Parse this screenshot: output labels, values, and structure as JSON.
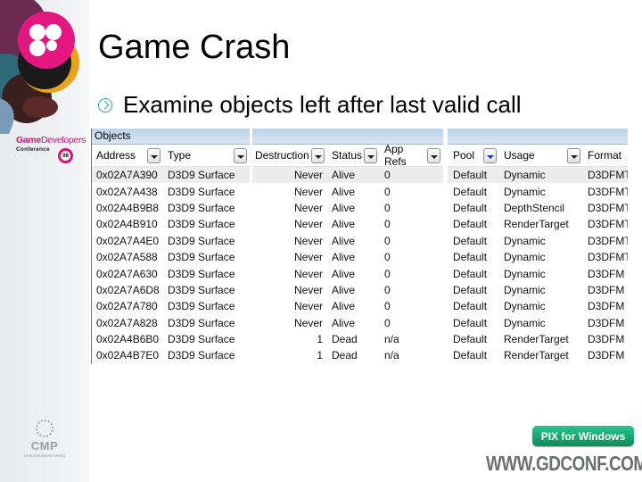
{
  "slide": {
    "title": "Game Crash",
    "bullets": [
      "Examine objects left after last valid call"
    ]
  },
  "branding": {
    "gdc_name_bold": "Game",
    "gdc_name_light": "Developers",
    "gdc_conference": "Conference",
    "gdc_year": "08",
    "cmp": "CMP",
    "cmp_sub": "United Business Media",
    "pix_label": "PIX for Windows",
    "url": "WWW.GDCONF.COM",
    "colors": {
      "gdc_magenta": "#d4147a",
      "pix_green": "#1aa874",
      "bullet_teal": "#2aa3a3"
    }
  },
  "objects_panel": {
    "title": "Objects",
    "columns": [
      "Address",
      "Type",
      "Destruction",
      "Status",
      "App Refs",
      "Pool",
      "Usage",
      "Format"
    ],
    "rows": [
      {
        "address": "0x02A7A390",
        "type": "D3D9 Surface",
        "destruction": "Never",
        "status": "Alive",
        "app_refs": "0",
        "pool": "Default",
        "usage": "Dynamic",
        "format": "D3DFMT"
      },
      {
        "address": "0x02A7A438",
        "type": "D3D9 Surface",
        "destruction": "Never",
        "status": "Alive",
        "app_refs": "0",
        "pool": "Default",
        "usage": "Dynamic",
        "format": "D3DFMT"
      },
      {
        "address": "0x02A4B9B8",
        "type": "D3D9 Surface",
        "destruction": "Never",
        "status": "Alive",
        "app_refs": "0",
        "pool": "Default",
        "usage": "DepthStencil",
        "format": "D3DFMT"
      },
      {
        "address": "0x02A4B910",
        "type": "D3D9 Surface",
        "destruction": "Never",
        "status": "Alive",
        "app_refs": "0",
        "pool": "Default",
        "usage": "RenderTarget",
        "format": "D3DFMT"
      },
      {
        "address": "0x02A7A4E0",
        "type": "D3D9 Surface",
        "destruction": "Never",
        "status": "Alive",
        "app_refs": "0",
        "pool": "Default",
        "usage": "Dynamic",
        "format": "D3DFMT"
      },
      {
        "address": "0x02A7A588",
        "type": "D3D9 Surface",
        "destruction": "Never",
        "status": "Alive",
        "app_refs": "0",
        "pool": "Default",
        "usage": "Dynamic",
        "format": "D3DFMT"
      },
      {
        "address": "0x02A7A630",
        "type": "D3D9 Surface",
        "destruction": "Never",
        "status": "Alive",
        "app_refs": "0",
        "pool": "Default",
        "usage": "Dynamic",
        "format": "D3DFM"
      },
      {
        "address": "0x02A7A6D8",
        "type": "D3D9 Surface",
        "destruction": "Never",
        "status": "Alive",
        "app_refs": "0",
        "pool": "Default",
        "usage": "Dynamic",
        "format": "D3DFM"
      },
      {
        "address": "0x02A7A780",
        "type": "D3D9 Surface",
        "destruction": "Never",
        "status": "Alive",
        "app_refs": "0",
        "pool": "Default",
        "usage": "Dynamic",
        "format": "D3DFM"
      },
      {
        "address": "0x02A7A828",
        "type": "D3D9 Surface",
        "destruction": "Never",
        "status": "Alive",
        "app_refs": "0",
        "pool": "Default",
        "usage": "Dynamic",
        "format": "D3DFM"
      },
      {
        "address": "0x02A4B6B0",
        "type": "D3D9 Surface",
        "destruction": "1",
        "status": "Dead",
        "app_refs": "n/a",
        "pool": "Default",
        "usage": "RenderTarget",
        "format": "D3DFM"
      },
      {
        "address": "0x02A4B7E0",
        "type": "D3D9 Surface",
        "destruction": "1",
        "status": "Dead",
        "app_refs": "n/a",
        "pool": "Default",
        "usage": "RenderTarget",
        "format": "D3DFM"
      }
    ],
    "selected_row": 0
  }
}
